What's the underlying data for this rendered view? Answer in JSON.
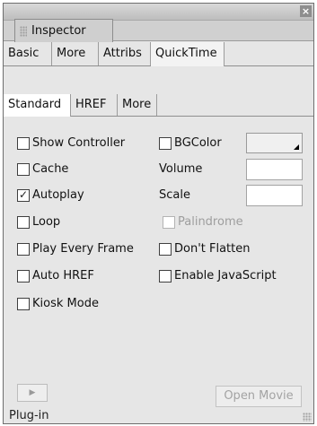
{
  "window": {
    "close_glyph": "×"
  },
  "panel": {
    "title": "Inspector"
  },
  "tabs_primary": [
    "Basic",
    "More",
    "Attribs",
    "QuickTime"
  ],
  "tabs_primary_active": "QuickTime",
  "tabs_secondary": [
    "Standard",
    "HREF",
    "More"
  ],
  "tabs_secondary_active": "Standard",
  "options_left": [
    {
      "label": "Show Controller",
      "checked": false
    },
    {
      "label": "Cache",
      "checked": false
    },
    {
      "label": "Autoplay",
      "checked": true
    },
    {
      "label": "Loop",
      "checked": false
    },
    {
      "label": "Play Every Frame",
      "checked": false
    },
    {
      "label": "Auto HREF",
      "checked": false
    },
    {
      "label": "Kiosk Mode",
      "checked": false
    }
  ],
  "options_right": {
    "bgcolor_label": "BGColor",
    "volume_label": "Volume",
    "volume_value": "",
    "scale_label": "Scale",
    "scale_value": "",
    "palindrome_label": "Palindrome",
    "palindrome_disabled": true,
    "dont_flatten_label": "Don't Flatten",
    "enable_js_label": "Enable JavaScript"
  },
  "buttons": {
    "play_glyph": "▶",
    "open_movie": "Open Movie"
  },
  "status": "Plug-in",
  "icons": [
    "close-icon",
    "grip-icon",
    "checkmark-icon",
    "play-icon",
    "dropdown-arrow-icon",
    "resize-grip-icon"
  ]
}
